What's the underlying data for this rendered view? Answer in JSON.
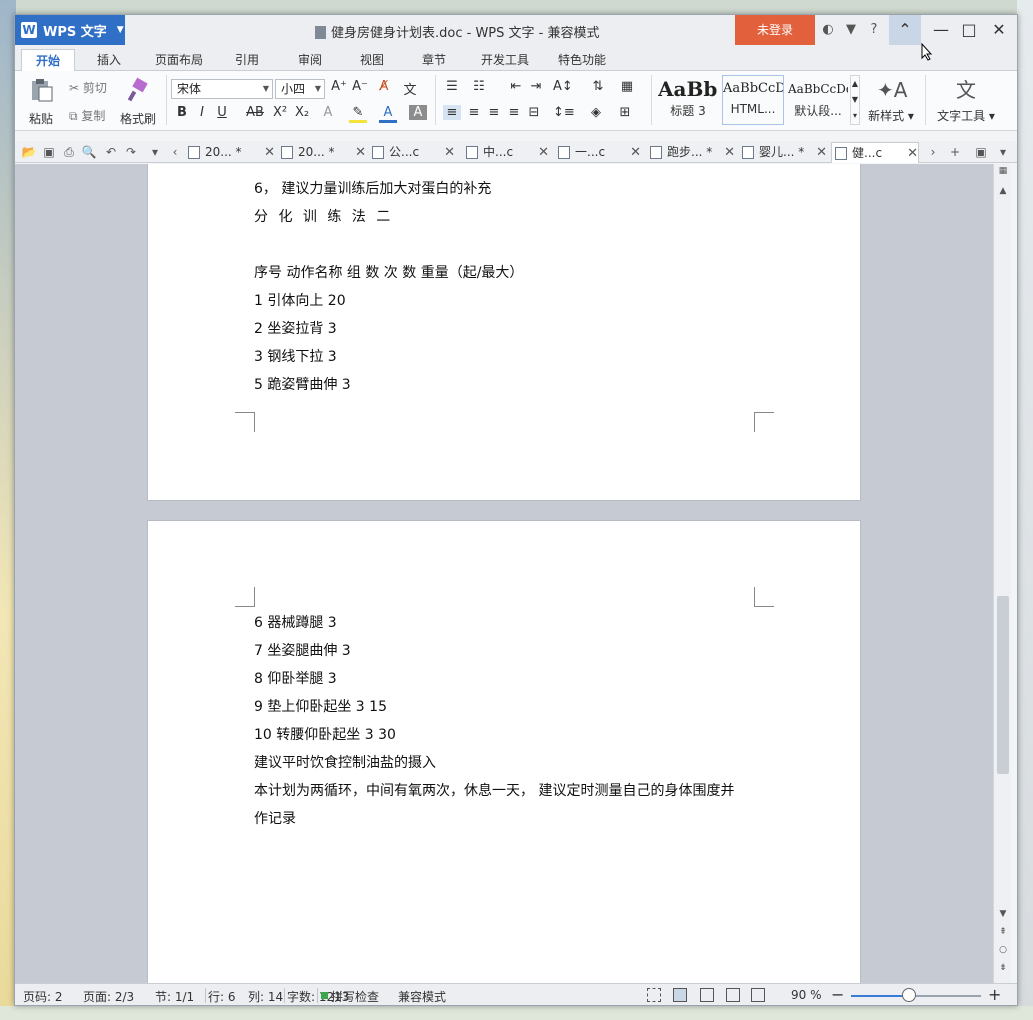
{
  "window": {
    "app_button_label": "WPS 文字",
    "title": "健身房健身计划表.doc - WPS 文字 - 兼容模式",
    "login_label": "未登录"
  },
  "menu_tabs": [
    "开始",
    "插入",
    "页面布局",
    "引用",
    "审阅",
    "视图",
    "章节",
    "开发工具",
    "特色功能"
  ],
  "ribbon": {
    "paste": "粘贴",
    "cut": "剪切",
    "copy": "复制",
    "format_painter": "格式刷",
    "font_name": "宋体",
    "font_size": "小四",
    "styles": [
      {
        "sample": "AaBbC",
        "name": "标题 3"
      },
      {
        "sample": "AaBbCcDd",
        "name": "HTML..."
      },
      {
        "sample": "AaBbCcDd",
        "name": "默认段..."
      }
    ],
    "new_style": "新样式",
    "text_tools": "文字工具"
  },
  "doc_tabs": [
    "20... *",
    "20... *",
    "公...c",
    "中...c",
    "一...c",
    "跑步... *",
    "婴儿... *",
    "健...c"
  ],
  "page1_lines": [
    "6， 建议力量训练后加大对蛋白的补充",
    "分 化 训 练 法 二",
    "序号 动作名称 组 数 次 数 重量（起/最大）",
    "1 引体向上 20",
    "2 坐姿拉背 3",
    "3 钢线下拉 3",
    "5 跪姿臂曲伸 3"
  ],
  "page2_lines": [
    "6 器械蹲腿 3",
    "7 坐姿腿曲伸 3",
    "8 仰卧举腿 3",
    "9 垫上仰卧起坐 3 15",
    "10 转腰仰卧起坐 3 30",
    "建议平时饮食控制油盐的摄入",
    "本计划为两循环，中间有氧两次，休息一天， 建议定时测量自己的身体围度并",
    "作记录"
  ],
  "status": {
    "page_num": "页码: 2",
    "pages": "页面: 2/3",
    "section": "节: 1/1",
    "row": "行: 6",
    "col": "列: 14",
    "word_count": "字数: 1213",
    "spell_check": "拼写检查",
    "compat": "兼容模式",
    "zoom": "90 %"
  },
  "colors": {
    "accent": "#2f6fc6",
    "login": "#e2603c",
    "spell_ok": "#3aa84a"
  }
}
